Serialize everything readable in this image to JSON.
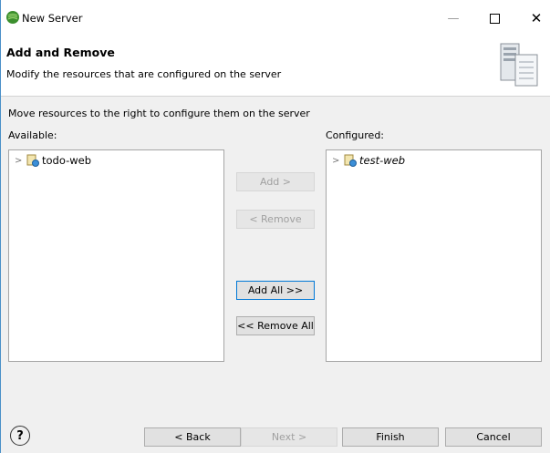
{
  "window": {
    "title": "New Server",
    "controls": {
      "minimize": "—",
      "maximize": "",
      "close": "✕"
    }
  },
  "header": {
    "title": "Add and Remove",
    "description": "Modify the resources that are configured on the server",
    "graphic_icon": "server-wizard-icon"
  },
  "main": {
    "instruction": "Move resources to the right to configure them on the server",
    "available": {
      "label": "Available:",
      "items": [
        {
          "label": "todo-web",
          "icon": "web-project-icon"
        }
      ]
    },
    "configured": {
      "label": "Configured:",
      "items": [
        {
          "label": "test-web",
          "icon": "web-project-icon"
        }
      ]
    },
    "buttons": {
      "add": "Add >",
      "remove": "< Remove",
      "add_all": "Add All >>",
      "remove_all": "<< Remove All"
    }
  },
  "footer": {
    "help": "?",
    "back": "< Back",
    "next": "Next >",
    "finish": "Finish",
    "cancel": "Cancel"
  },
  "colors": {
    "accent": "#0078d7",
    "window_border": "#4a90c8",
    "dialog_bg": "#f0f0f0",
    "disabled_text": "#a0a0a0"
  }
}
